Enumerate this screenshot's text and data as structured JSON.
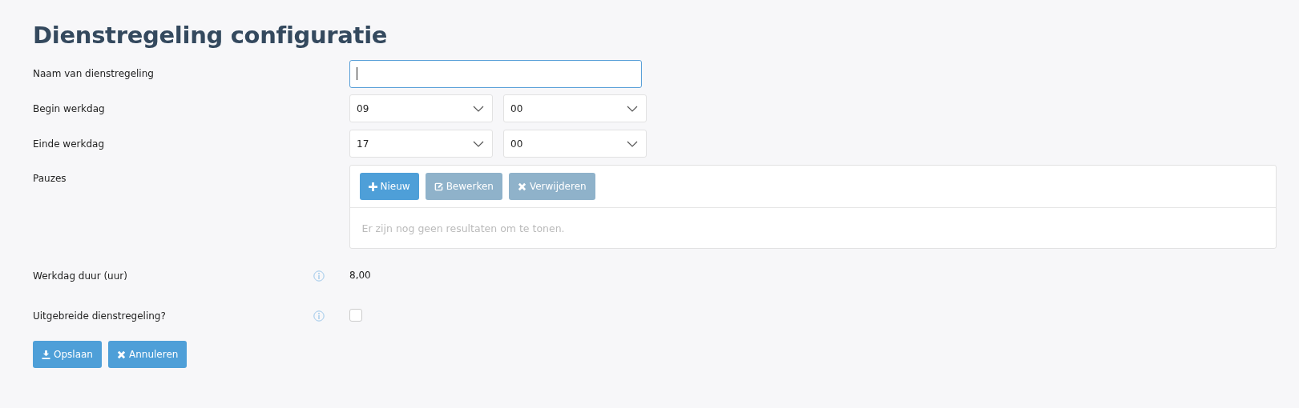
{
  "title": "Dienstregeling configuratie",
  "name_field": {
    "label": "Naam van dienstregeling",
    "focused": true
  },
  "time_rows": [
    {
      "label": "Begin werkdag",
      "hour": "09",
      "minute": "00"
    },
    {
      "label": "Einde werkdag",
      "hour": "17",
      "minute": "00"
    }
  ],
  "pauses": {
    "label": "Pauzes",
    "buttons": [
      {
        "label": "Nieuw",
        "kind": "add",
        "disabled": false
      },
      {
        "label": "Bewerken",
        "kind": "edit",
        "disabled": true
      },
      {
        "label": "Verwijderen",
        "kind": "delete",
        "disabled": true
      }
    ],
    "empty_text": "Er zijn nog geen resultaten om te tonen."
  },
  "duration": {
    "label": "Werkdag duur (uur)",
    "value": "8,00"
  },
  "extended": {
    "label": "Uitgebreide dienstregeling?",
    "checked": false
  },
  "actions": [
    {
      "label": "Opslaan",
      "kind": "save"
    },
    {
      "label": "Annuleren",
      "kind": "cancel"
    }
  ]
}
